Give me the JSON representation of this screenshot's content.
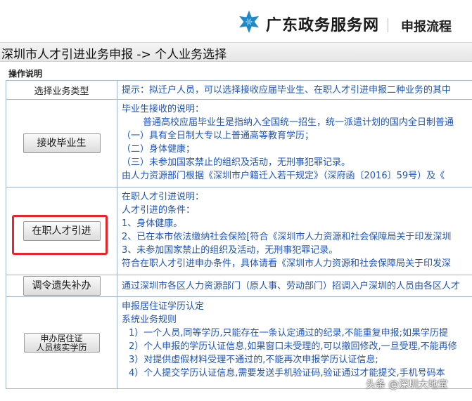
{
  "header": {
    "logo_icon": "snowflake-logo-icon",
    "brand_color": "#1e88c8",
    "site_name": "广东政务服务网",
    "flow_link": "申报流程"
  },
  "page_title": "深圳市人才引进业务申报 -> 个人业务选择",
  "section_label": "操作说明",
  "table": {
    "head_left": "选择业务类型",
    "head_right": "提示：拟迁户人员，可以选择接收应届毕业生、在职人才引进申报二种业务的其中",
    "rows": [
      {
        "button": "接收毕业生",
        "lines": [
          "毕业生接收的说明：",
          "普通高校应届毕业生是指纳入全国统一招生，统一派遣计划的国内全日制普通",
          "（一）具有全日制大专以上普通高等教育学历；",
          "（二）身体健康；",
          "（三）未参加国家禁止的组织及活动，无刑事犯罪记录。",
          "由人力资源部门根据《深圳市户籍迁入若干规定》（深府函〔2016〕59号）及《"
        ]
      },
      {
        "button": "在职人才引进",
        "lines": [
          "在职人才引进说明：",
          "人才引进的条件：",
          "1、身体健康。",
          "2、已在本市依法缴纳社会保险[符合《深圳市人力资源和社会保障局关于印发深圳",
          "3、未参加国家禁止的组织及活动，无刑事犯罪记录。",
          "符合在职人才引进申办条件，具体请看《深圳市人力资源和社会保障局关于印发深"
        ]
      },
      {
        "button": "调令遗失补办",
        "lines": [
          "通过深圳市各区人力资源部门（原人事、劳动部门）招调入户深圳的人员由各区人才"
        ]
      },
      {
        "button_line1": "申办居住证",
        "button_line2": "人员核实学历",
        "lines": [
          "申报居住证学历认定",
          "系统业务规则",
          "1）一个人员,同等学历,只能存在一条认定通过的纪录,不能重复申报;如果学历提",
          "2）个人申报的学历认证信息,如果窗口未受理的,可以撤回修改,一旦受理,不能再修",
          "3）对提供虚假材料受理不通过的,不能再次申报学历认证信息;",
          "4）个人提交学历认证信息,需要发送手机验证码,验证通过才能提交,手机号码本"
        ]
      }
    ]
  },
  "watermark": "头条 @深圳大地宝"
}
